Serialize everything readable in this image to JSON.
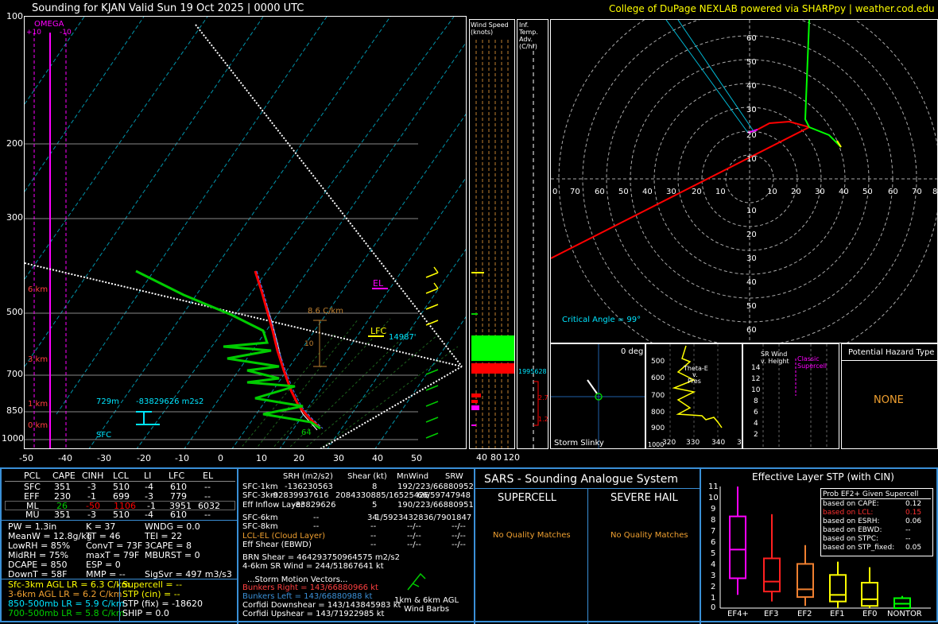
{
  "header": {
    "title": "Sounding for KJAN Valid  Sun 19 Oct 2025 | 0000 UTC",
    "credit": "College of DuPage NEXLAB powered via SHARPpy | weather.cod.edu"
  },
  "skewt": {
    "omega_label": "OMEGA",
    "omega_ticks": [
      "+10",
      "-10"
    ],
    "pressure_labels": [
      "100",
      "200",
      "300",
      "500",
      "700",
      "850",
      "1000"
    ],
    "temp_labels": [
      "-50",
      "-40",
      "-30",
      "-20",
      "-10",
      "0",
      "10",
      "20",
      "30",
      "40",
      "50"
    ],
    "height_labels": [
      "6 km",
      "3 km",
      "1 km",
      "0 km"
    ],
    "lapse_label": "8.6 C/km",
    "lapse_small": "10",
    "el_label": "EL",
    "lfc_label": "LFC",
    "lfc_value": "14987'",
    "eil_depth": "729m",
    "eil_srh": "-83829626 m2s2",
    "sfc_label": "SFC",
    "sfc_wind": "64"
  },
  "wind_speed_panel": {
    "title": "Wind Speed (knots)",
    "ticks": [
      "40",
      "80",
      "120"
    ]
  },
  "temp_adv_panel": {
    "title": "Inf. Temp. Adv.(C/hr)",
    "value_right": "1995628",
    "val1": "2.7",
    "val2": "1.2"
  },
  "hodograph": {
    "ring_labels_y": [
      "60",
      "50",
      "40",
      "30",
      "20",
      "10"
    ],
    "ring_labels_y_neg": [
      "10",
      "20",
      "30",
      "40",
      "50",
      "60"
    ],
    "axis_labels_x": [
      "0",
      "70",
      "60",
      "50",
      "40",
      "30",
      "20",
      "10",
      "",
      "10",
      "20",
      "30",
      "40",
      "50",
      "60",
      "70",
      "8"
    ],
    "critical_angle": "Critical Angle = 99°"
  },
  "storm_slinky": {
    "label": "Storm Slinky",
    "deg": "0 deg"
  },
  "theta_panel": {
    "y_labels": [
      "500",
      "600",
      "700",
      "800",
      "900"
    ],
    "x_labels": [
      "320",
      "330",
      "340",
      "3"
    ],
    "y_bottom": "1000",
    "legend": [
      "Theta-E",
      "v.",
      "Pres"
    ]
  },
  "srwind_panel": {
    "title": "SR Wind v. Height",
    "classic": "Classic Supercell",
    "y_labels": [
      "14",
      "12",
      "10",
      "8",
      "6",
      "4",
      "2"
    ]
  },
  "hazard": {
    "title": "Potential Hazard Type",
    "value": "NONE"
  },
  "parcel_table": {
    "headers": [
      "PCL",
      "CAPE",
      "CINH",
      "LCL",
      "LI",
      "LFC",
      "EL"
    ],
    "rows": [
      [
        "SFC",
        "351",
        "-3",
        "510",
        "-4",
        "610",
        "--"
      ],
      [
        "EFF",
        "230",
        "-1",
        "699",
        "-3",
        "779",
        "--"
      ],
      [
        "ML",
        "26",
        "-50",
        "1106",
        "-1",
        "3951",
        "6032"
      ],
      [
        "MU",
        "351",
        "-3",
        "510",
        "-4",
        "610",
        "--"
      ]
    ]
  },
  "indices": {
    "col1": [
      "PW = 1.3in",
      "MeanW = 12.8g/kg",
      "LowRH = 85%",
      "MidRH = 75%",
      "DCAPE = 850",
      "DownT = 58F"
    ],
    "col2": [
      "K = 37",
      "TT = 46",
      "ConvT = 73F",
      "maxT = 79F",
      "ESP = 0",
      "MMP = --"
    ],
    "col3": [
      "WNDG = 0.0",
      "TEI = 22",
      "3CAPE = 8",
      "MBURST = 0",
      "",
      "SigSvr = 497 m3/s3"
    ]
  },
  "lapse_rates": [
    "Sfc-3km AGL LR = 6.3 C/km",
    "3-6km AGL LR = 6.2 C/km",
    "850-500mb LR = 5.9 C/km",
    "700-500mb LR = 5.8 C/km"
  ],
  "composites": [
    "Supercell = --",
    "STP (cin) = --",
    "STP (fix) = -18620",
    "SHIP = 0.0"
  ],
  "kinematics": {
    "headers": [
      "SRH (m2/s2)",
      "Shear (kt)",
      "MnWind",
      "SRW"
    ],
    "rows": [
      [
        "SFC-1km",
        "-136230563",
        "8",
        "192/223/66880952",
        ""
      ],
      [
        "SFC-3km",
        "-92839937616",
        "2084330885/16525426",
        "66/59747948",
        ""
      ],
      [
        "Eff Inflow Layer",
        "-83829626",
        "5",
        "190/223/66880951",
        ""
      ],
      [
        "SFC-6km",
        "--",
        "34",
        "1/5923432836/7901847",
        ""
      ],
      [
        "SFC-8km",
        "--",
        "--",
        "--/--",
        "--/--"
      ],
      [
        "LCL-EL (Cloud Layer)",
        "--",
        "--",
        "--/--",
        "--/--"
      ],
      [
        "Eff Shear (EBWD)",
        "--",
        "--",
        "--/--",
        "--/--"
      ]
    ],
    "brn": "BRN Shear = 464293750964575 m2/s2",
    "sr46": "4-6km SR Wind =   244/51867641 kt",
    "storm_motion_title": "...Storm Motion Vectors...",
    "bunkers_right": "Bunkers Right =   143/66880966 kt",
    "bunkers_left": "Bunkers Left =   143/66880988 kt",
    "corfidi_down": "Corfidi Downshear = 143/143845983 kt",
    "corfidi_up": "Corfidi Upshear =   143/71922985 kt",
    "barbs_label": "1km & 6km AGL\nWind Barbs"
  },
  "sars": {
    "title": "SARS - Sounding Analogue System",
    "supercell": "SUPERCELL",
    "hail": "SEVERE HAIL",
    "supercell_match": "No Quality Matches",
    "hail_match": "No Quality Matches"
  },
  "stp": {
    "title": "Effective Layer STP (with CIN)",
    "y_labels": [
      "11",
      "10",
      "9",
      "8",
      "7",
      "6",
      "5",
      "4",
      "3",
      "2",
      "1",
      "0"
    ],
    "categories": [
      "EF4+",
      "EF3",
      "EF2",
      "EF1",
      "EF0",
      "NONTOR"
    ],
    "prob_title": "Prob EF2+ Given Supercell",
    "prob_rows": [
      [
        "based on CAPE:",
        "0.12"
      ],
      [
        "based on LCL:",
        "0.15"
      ],
      [
        "based on ESRH:",
        "0.06"
      ],
      [
        "based on EBWD:",
        "--"
      ],
      [
        "based on STPC:",
        "--"
      ],
      [
        "based on STP_fixed:",
        "0.05"
      ]
    ]
  },
  "colors": {
    "frame": "#3a8fd6",
    "temp": "#ff0000",
    "dewpoint": "#00cc00",
    "parcel": "#ffffff",
    "label_yellow": "#ffff00",
    "label_cyan": "#00e5ff",
    "magenta": "#ff00ff"
  }
}
